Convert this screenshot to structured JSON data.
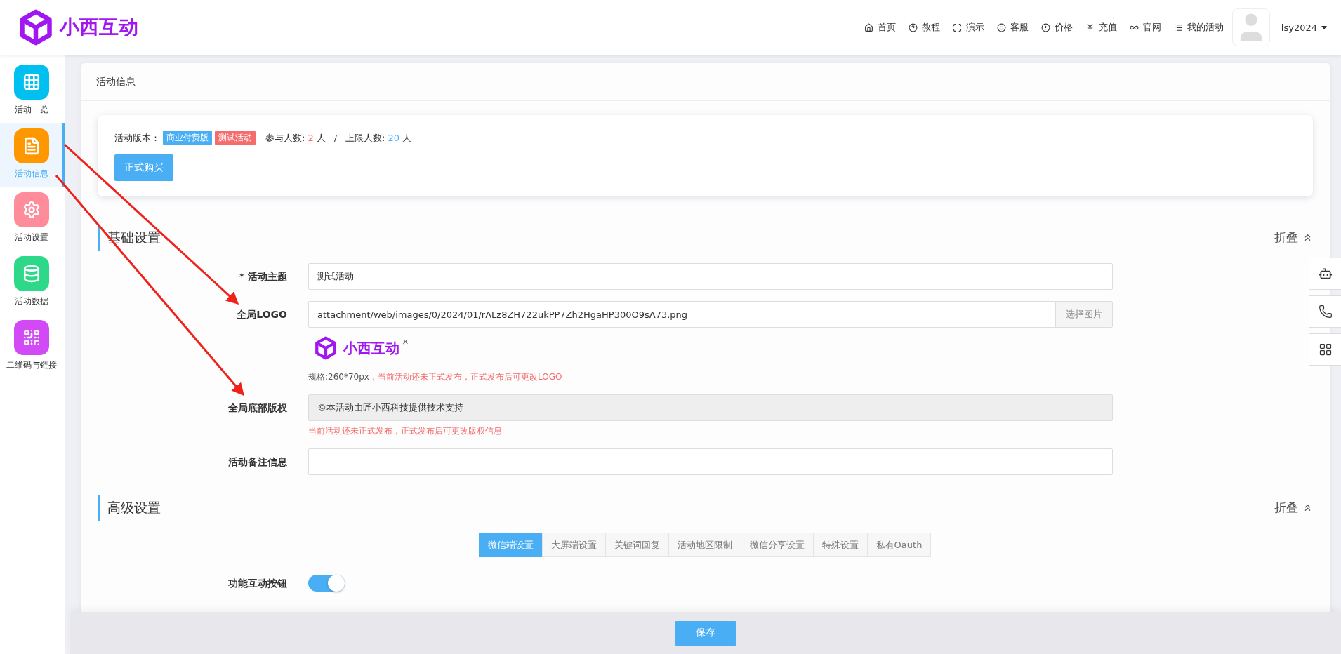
{
  "header": {
    "logo_text": "小西互动",
    "nav": [
      {
        "kind": "home",
        "label": "首页"
      },
      {
        "kind": "help",
        "label": "教程"
      },
      {
        "kind": "expand",
        "label": "演示"
      },
      {
        "kind": "smile",
        "label": "客服"
      },
      {
        "kind": "badge",
        "label": "价格"
      },
      {
        "kind": "yen",
        "label": "充值"
      },
      {
        "kind": "infinity",
        "label": "官网"
      },
      {
        "kind": "list",
        "label": "我的活动"
      }
    ],
    "username": "lsy2024"
  },
  "sidebar": {
    "items": [
      {
        "kind": "grid",
        "label": "活动一览",
        "color": "#00c0ef",
        "selected": false
      },
      {
        "kind": "document",
        "label": "活动信息",
        "color": "#ff9800",
        "selected": true
      },
      {
        "kind": "gear",
        "label": "活动设置",
        "color": "#ff8c9a",
        "selected": false
      },
      {
        "kind": "database",
        "label": "活动数据",
        "color": "#2ed889",
        "selected": false
      },
      {
        "kind": "qrcode",
        "label": "二维码与链接",
        "color": "#d24af5",
        "selected": false
      }
    ]
  },
  "page_title": "活动信息",
  "info": {
    "version_label": "活动版本：",
    "tags": [
      {
        "label": "商业付费版",
        "color": "#4aaef5"
      },
      {
        "label": "测试活动",
        "color": "#f56c6c"
      }
    ],
    "participants_label": "参与人数:",
    "participants": "2",
    "participants_unit": "人",
    "separator": "/",
    "limit_label": "上限人数:",
    "limit": "20",
    "limit_unit": "人",
    "buy_button": "正式购买"
  },
  "basic": {
    "title": "基础设置",
    "collapse": "折叠",
    "fields": [
      {
        "kind": "text",
        "label": "* 活动主题",
        "value": "测试活动"
      },
      {
        "kind": "image",
        "label": "全局LOGO",
        "value": "attachment/web/images/0/2024/01/rALz8ZH722ukPP7Zh2HgaHP300O9sA73.png",
        "button": "选择图片",
        "preview_text": "小西互动",
        "remove": "×",
        "hint": "规格:260*70px",
        "warning": "，当前活动还未正式发布，正式发布后可更改LOGO"
      },
      {
        "kind": "readonly",
        "label": "全局底部版权",
        "value": "©本活动由匠小西科技提供技术支持",
        "warning": "当前活动还未正式发布，正式发布后可更改版权信息"
      },
      {
        "kind": "text",
        "label": "活动备注信息"
      }
    ]
  },
  "advanced": {
    "title": "高级设置",
    "collapse": "折叠",
    "tabs": [
      {
        "label": "微信端设置",
        "selected": true
      },
      {
        "label": "大屏端设置",
        "selected": false
      },
      {
        "label": "关键词回复",
        "selected": false
      },
      {
        "label": "活动地区限制",
        "selected": false
      },
      {
        "label": "微信分享设置",
        "selected": false
      },
      {
        "label": "特殊设置",
        "selected": false
      },
      {
        "label": "私有Oauth",
        "selected": false
      }
    ],
    "toggle": {
      "label": "功能互动按钮",
      "on": true
    }
  },
  "footer": {
    "save_button": "保存"
  }
}
